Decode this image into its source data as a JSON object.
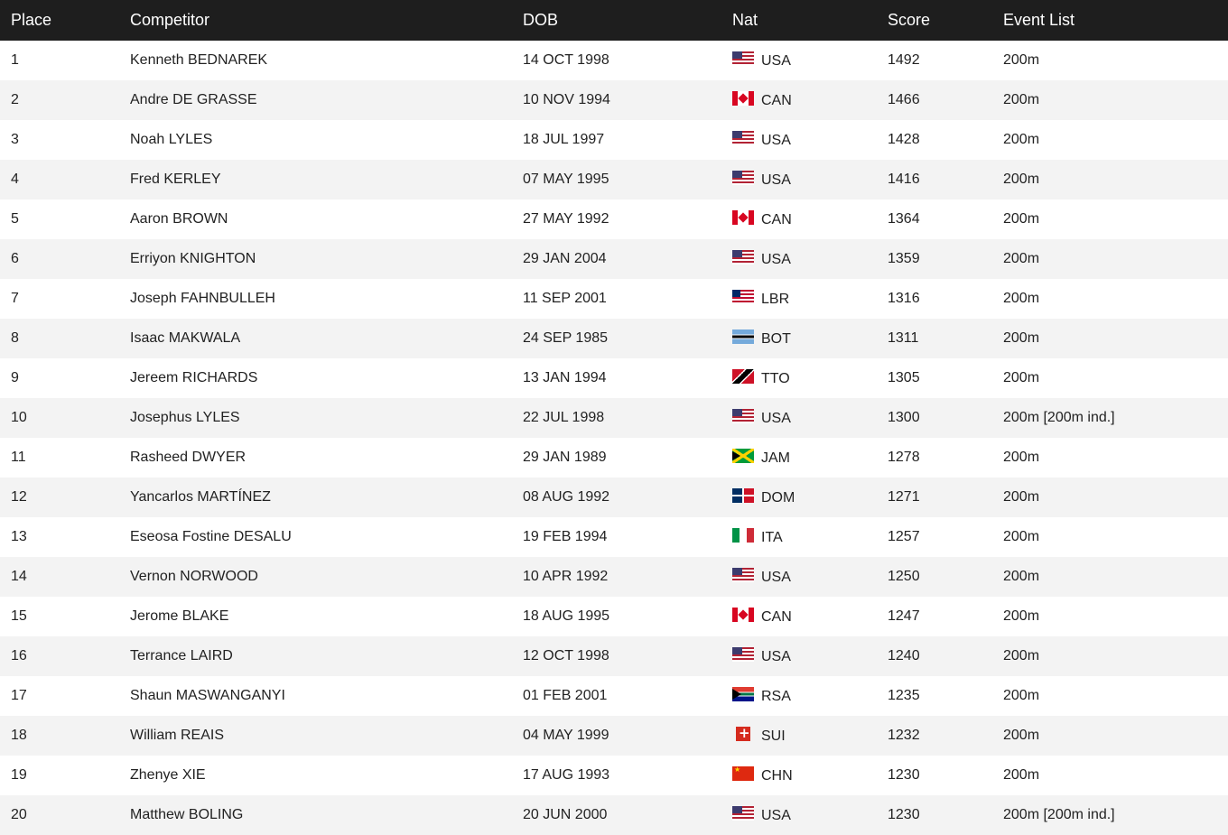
{
  "columns": [
    "Place",
    "Competitor",
    "DOB",
    "Nat",
    "Score",
    "Event List"
  ],
  "rows": [
    {
      "place": "1",
      "competitor": "Kenneth BEDNAREK",
      "dob": "14 OCT 1998",
      "nat": "USA",
      "flag": "usa-flag-icon",
      "score": "1492",
      "events": "200m"
    },
    {
      "place": "2",
      "competitor": "Andre DE GRASSE",
      "dob": "10 NOV 1994",
      "nat": "CAN",
      "flag": "canada-flag-icon",
      "score": "1466",
      "events": "200m"
    },
    {
      "place": "3",
      "competitor": "Noah LYLES",
      "dob": "18 JUL 1997",
      "nat": "USA",
      "flag": "usa-flag-icon",
      "score": "1428",
      "events": "200m"
    },
    {
      "place": "4",
      "competitor": "Fred KERLEY",
      "dob": "07 MAY 1995",
      "nat": "USA",
      "flag": "usa-flag-icon",
      "score": "1416",
      "events": "200m"
    },
    {
      "place": "5",
      "competitor": "Aaron BROWN",
      "dob": "27 MAY 1992",
      "nat": "CAN",
      "flag": "canada-flag-icon",
      "score": "1364",
      "events": "200m"
    },
    {
      "place": "6",
      "competitor": "Erriyon KNIGHTON",
      "dob": "29 JAN 2004",
      "nat": "USA",
      "flag": "usa-flag-icon",
      "score": "1359",
      "events": "200m"
    },
    {
      "place": "7",
      "competitor": "Joseph FAHNBULLEH",
      "dob": "11 SEP 2001",
      "nat": "LBR",
      "flag": "liberia-flag-icon",
      "score": "1316",
      "events": "200m"
    },
    {
      "place": "8",
      "competitor": "Isaac MAKWALA",
      "dob": "24 SEP 1985",
      "nat": "BOT",
      "flag": "botswana-flag-icon",
      "score": "1311",
      "events": "200m"
    },
    {
      "place": "9",
      "competitor": "Jereem RICHARDS",
      "dob": "13 JAN 1994",
      "nat": "TTO",
      "flag": "trinidad-tobago-flag-icon",
      "score": "1305",
      "events": "200m"
    },
    {
      "place": "10",
      "competitor": "Josephus LYLES",
      "dob": "22 JUL 1998",
      "nat": "USA",
      "flag": "usa-flag-icon",
      "score": "1300",
      "events": "200m [200m ind.]"
    },
    {
      "place": "11",
      "competitor": "Rasheed DWYER",
      "dob": "29 JAN 1989",
      "nat": "JAM",
      "flag": "jamaica-flag-icon",
      "score": "1278",
      "events": "200m"
    },
    {
      "place": "12",
      "competitor": "Yancarlos MARTÍNEZ",
      "dob": "08 AUG 1992",
      "nat": "DOM",
      "flag": "dominican-republic-flag-icon",
      "score": "1271",
      "events": "200m"
    },
    {
      "place": "13",
      "competitor": "Eseosa Fostine DESALU",
      "dob": "19 FEB 1994",
      "nat": "ITA",
      "flag": "italy-flag-icon",
      "score": "1257",
      "events": "200m"
    },
    {
      "place": "14",
      "competitor": "Vernon NORWOOD",
      "dob": "10 APR 1992",
      "nat": "USA",
      "flag": "usa-flag-icon",
      "score": "1250",
      "events": "200m"
    },
    {
      "place": "15",
      "competitor": "Jerome BLAKE",
      "dob": "18 AUG 1995",
      "nat": "CAN",
      "flag": "canada-flag-icon",
      "score": "1247",
      "events": "200m"
    },
    {
      "place": "16",
      "competitor": "Terrance LAIRD",
      "dob": "12 OCT 1998",
      "nat": "USA",
      "flag": "usa-flag-icon",
      "score": "1240",
      "events": "200m"
    },
    {
      "place": "17",
      "competitor": "Shaun MASWANGANYI",
      "dob": "01 FEB 2001",
      "nat": "RSA",
      "flag": "south-africa-flag-icon",
      "score": "1235",
      "events": "200m"
    },
    {
      "place": "18",
      "competitor": "William REAIS",
      "dob": "04 MAY 1999",
      "nat": "SUI",
      "flag": "switzerland-flag-icon",
      "score": "1232",
      "events": "200m"
    },
    {
      "place": "19",
      "competitor": "Zhenye XIE",
      "dob": "17 AUG 1993",
      "nat": "CHN",
      "flag": "china-flag-icon",
      "score": "1230",
      "events": "200m"
    },
    {
      "place": "20",
      "competitor": "Matthew BOLING",
      "dob": "20 JUN 2000",
      "nat": "USA",
      "flag": "usa-flag-icon",
      "score": "1230",
      "events": "200m [200m ind.]"
    }
  ],
  "colors": {
    "header_bg": "#1e1e1e",
    "header_text": "#ffffff",
    "stripe": "#f3f3f3"
  }
}
